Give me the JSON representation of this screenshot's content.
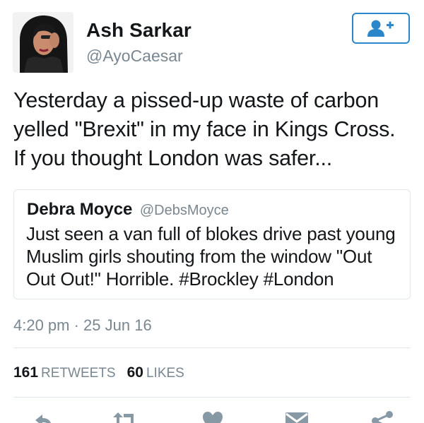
{
  "author": {
    "display_name": "Ash Sarkar",
    "handle": "@AyoCaesar",
    "avatar": "avatar-photo"
  },
  "follow_button": {
    "icon": "follow-person-plus-icon",
    "color": "#2b87c9"
  },
  "tweet": {
    "text": "Yesterday a pissed-up waste of carbon\nyelled \"Brexit\" in my face in Kings Cross.\nIf you thought London was safer..."
  },
  "quoted_tweet": {
    "display_name": "Debra Moyce",
    "handle": "@DebsMoyce",
    "text": "Just seen a van full of blokes drive past young\nMuslim girls shouting from the window  \"Out\nOut Out!\" Horrible. #Brockley #London"
  },
  "timestamp": "4:20 pm · 25 Jun 16",
  "stats": {
    "retweets_count": "161",
    "retweets_label": "RETWEETS",
    "likes_count": "60",
    "likes_label": "LIKES"
  },
  "actions": [
    "reply-icon",
    "retweet-icon",
    "like-heart-icon",
    "direct-message-icon",
    "share-icon"
  ],
  "colors": {
    "accent": "#2b87c9",
    "text": "#14171a",
    "secondary_text": "#7a8791",
    "divider": "#e1e8ed",
    "action_icon": "#8899a6"
  }
}
